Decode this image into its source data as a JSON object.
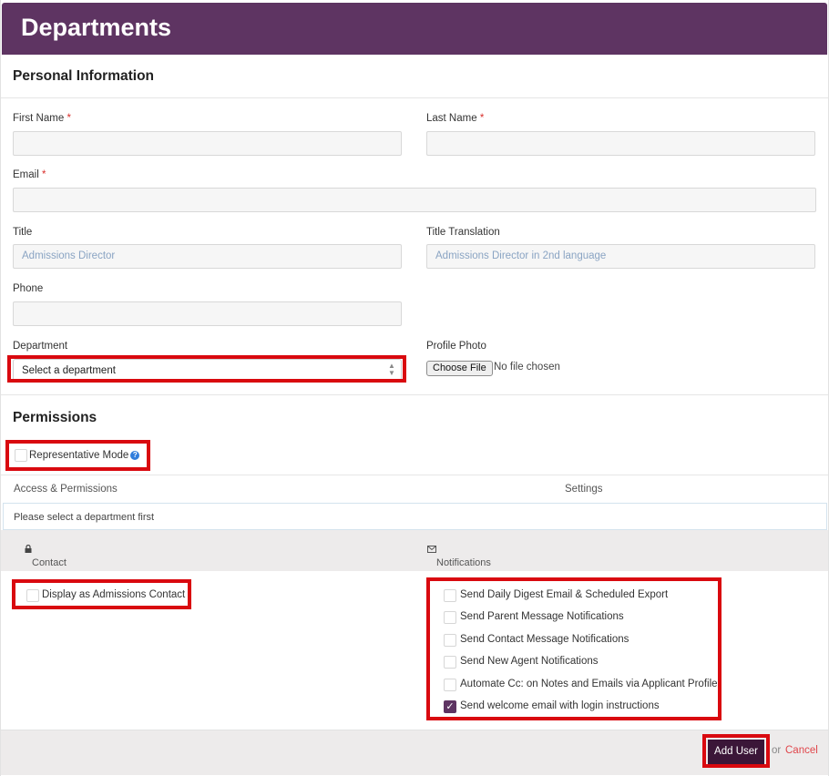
{
  "header": {
    "title": "Departments"
  },
  "personal": {
    "section_title": "Personal Information",
    "first_name": {
      "label": "First Name",
      "required_mark": "*",
      "value": ""
    },
    "last_name": {
      "label": "Last Name",
      "required_mark": "*",
      "value": ""
    },
    "email": {
      "label": "Email",
      "required_mark": "*",
      "value": ""
    },
    "title": {
      "label": "Title",
      "placeholder": "Admissions Director"
    },
    "title_translation": {
      "label": "Title Translation",
      "placeholder": "Admissions Director in 2nd language"
    },
    "phone": {
      "label": "Phone",
      "value": ""
    },
    "department": {
      "label": "Department",
      "selected": "Select a department"
    },
    "profile_photo": {
      "label": "Profile Photo",
      "button": "Choose File",
      "status": "No file chosen"
    }
  },
  "permissions": {
    "section_title": "Permissions",
    "representative_mode": {
      "label": "Representative Mode",
      "checked": false,
      "help_icon": "question-circle-icon"
    },
    "col_access": "Access & Permissions",
    "col_settings": "Settings",
    "info": "Please select a department first",
    "contact_header": {
      "icon": "lock-icon",
      "label": "Contact"
    },
    "notifications_header": {
      "icon": "envelope-icon",
      "label": "Notifications"
    },
    "display_contact": {
      "label": "Display as Admissions Contact",
      "checked": false
    },
    "notifications": [
      {
        "label": "Send Daily Digest Email & Scheduled Export",
        "checked": false
      },
      {
        "label": "Send Parent Message Notifications",
        "checked": false
      },
      {
        "label": "Send Contact Message Notifications",
        "checked": false
      },
      {
        "label": "Send New Agent Notifications",
        "checked": false
      },
      {
        "label": "Automate Cc: on Notes and Emails via Applicant Profile",
        "checked": false
      },
      {
        "label": "Send welcome email with login instructions",
        "checked": true
      }
    ]
  },
  "footer": {
    "add_label": "Add User",
    "or_text": "or",
    "cancel_label": "Cancel"
  },
  "colors": {
    "header_bg": "#5e3462",
    "highlight": "#d9090f",
    "button_bg": "#3b1638",
    "cancel": "#e0464b",
    "required": "#d9302c"
  }
}
